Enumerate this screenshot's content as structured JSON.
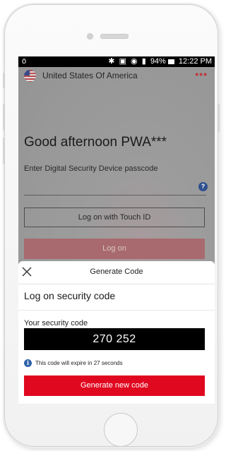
{
  "status_bar": {
    "left_icon": "ö",
    "icons": [
      "bluetooth-icon",
      "nfc-icon",
      "alarm-icon",
      "signal-icon"
    ],
    "battery": "94%",
    "time": "12:22 PM"
  },
  "app": {
    "country": "United States Of America",
    "more_icon": "•••",
    "greeting": "Good afternoon PWA***",
    "passcode_prompt": "Enter Digital Security Device passcode",
    "help_icon": "?",
    "touch_id_button": "Log on with Touch ID",
    "logon_button": "Log on"
  },
  "sheet": {
    "title": "Generate Code",
    "heading": "Log on security code",
    "code_label": "Your security code",
    "code": "270 252",
    "info_icon": "i",
    "expiry_text": "This code will expire in 27 seconds",
    "generate_button": "Generate new code"
  },
  "colors": {
    "brand_red": "#e0081f",
    "info_blue": "#2d62a8",
    "help_blue": "#2d4f8e"
  }
}
